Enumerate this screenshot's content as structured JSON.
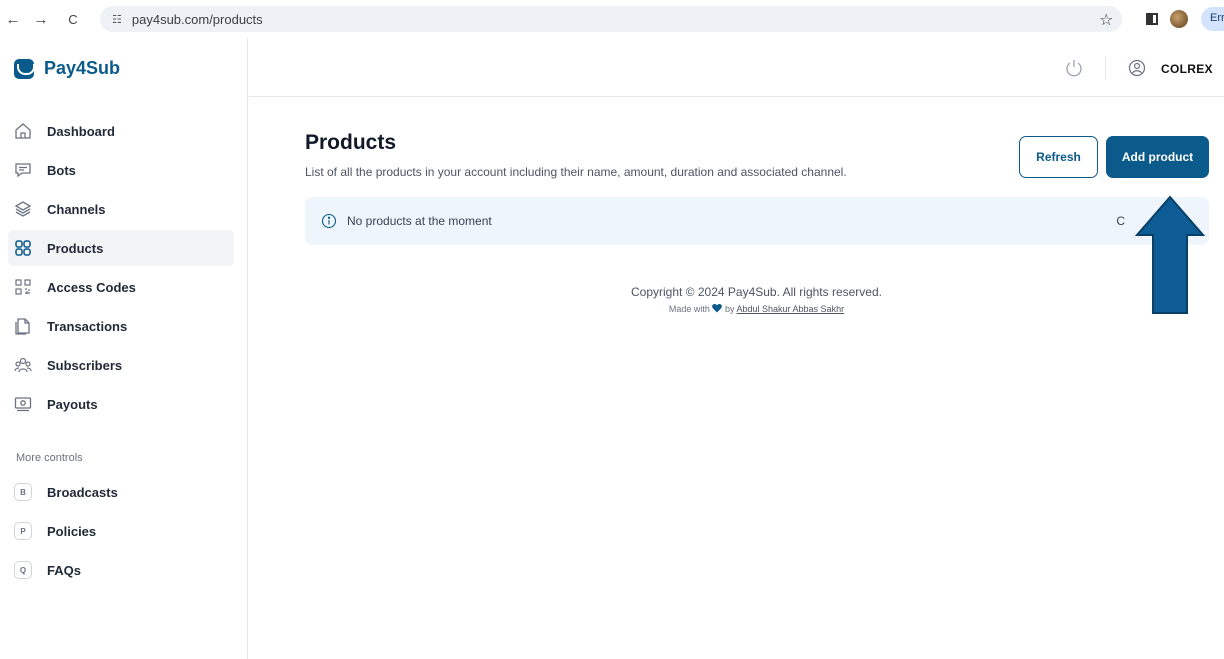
{
  "browser": {
    "back_icon": "←",
    "forward_icon": "→",
    "reload_icon": "C",
    "url": "pay4sub.com/products",
    "profile_label": "Err"
  },
  "app": {
    "brand": "Pay4Sub"
  },
  "sidebar": {
    "items": [
      {
        "label": "Dashboard",
        "icon": "home-icon"
      },
      {
        "label": "Bots",
        "icon": "chat-icon"
      },
      {
        "label": "Channels",
        "icon": "layers-icon"
      },
      {
        "label": "Products",
        "icon": "grid-icon",
        "active": true
      },
      {
        "label": "Access Codes",
        "icon": "qr-icon"
      },
      {
        "label": "Transactions",
        "icon": "document-icon"
      },
      {
        "label": "Subscribers",
        "icon": "users-icon"
      },
      {
        "label": "Payouts",
        "icon": "money-icon"
      }
    ],
    "more_label": "More controls",
    "more_items": [
      {
        "badge": "B",
        "label": "Broadcasts"
      },
      {
        "badge": "P",
        "label": "Policies"
      },
      {
        "badge": "Q",
        "label": "FAQs"
      }
    ]
  },
  "topbar": {
    "user_name": "COLREX"
  },
  "main": {
    "title": "Products",
    "description": "List of all the products in your account including their name, amount, duration and associated channel.",
    "refresh_label": "Refresh",
    "add_label": "Add product",
    "empty_message": "No products at the moment",
    "alert_tail": "C"
  },
  "footer": {
    "copyright": "Copyright © 2024 Pay4Sub. All rights reserved.",
    "made_with": "Made with",
    "by": "by",
    "author": "Abdul Shakur Abbas Sakhr"
  },
  "colors": {
    "brand": "#0b5a8c",
    "alert_bg": "#eef5fc",
    "arrow": "#0d5c96"
  }
}
